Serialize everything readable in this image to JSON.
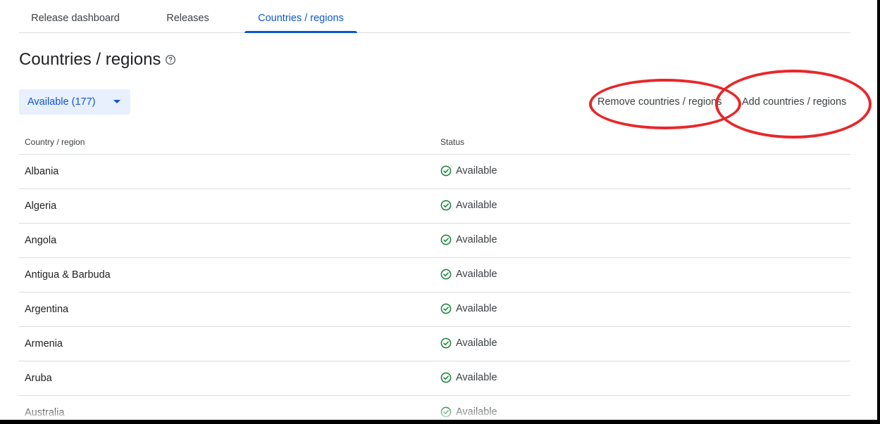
{
  "tabs": [
    {
      "label": "Release dashboard",
      "active": false
    },
    {
      "label": "Releases",
      "active": false
    },
    {
      "label": "Countries / regions",
      "active": true
    }
  ],
  "page_title": "Countries / regions",
  "filter": {
    "label": "Available (177)"
  },
  "actions": {
    "remove_label": "Remove countries / regions",
    "add_label": "Add countries / regions"
  },
  "table": {
    "headers": {
      "country": "Country / region",
      "status": "Status"
    },
    "rows": [
      {
        "country": "Albania",
        "status": "Available"
      },
      {
        "country": "Algeria",
        "status": "Available"
      },
      {
        "country": "Angola",
        "status": "Available"
      },
      {
        "country": "Antigua & Barbuda",
        "status": "Available"
      },
      {
        "country": "Argentina",
        "status": "Available"
      },
      {
        "country": "Armenia",
        "status": "Available"
      },
      {
        "country": "Aruba",
        "status": "Available"
      },
      {
        "country": "Australia",
        "status": "Available"
      }
    ]
  },
  "colors": {
    "accent": "#0b57d0",
    "status_ok": "#188038",
    "annotation": "#e8272a"
  },
  "icons": {
    "help": "help-circle-icon",
    "status": "check-circle-icon",
    "caret": "caret-down-icon"
  }
}
